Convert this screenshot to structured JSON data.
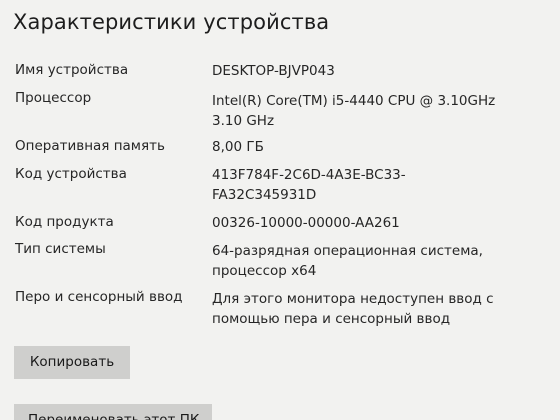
{
  "section": {
    "title": "Характеристики устройства"
  },
  "specs": [
    {
      "label": "Имя устройства",
      "value": [
        "DESKTOP-BJVP043"
      ]
    },
    {
      "label": "Процессор",
      "value": [
        "Intel(R) Core(TM) i5-4440 CPU @ 3.10GHz",
        "3.10 GHz"
      ]
    },
    {
      "label": "Оперативная память",
      "value": [
        "8,00 ГБ"
      ]
    },
    {
      "label": "Код устройства",
      "value": [
        "413F784F-2C6D-4A3E-BC33-",
        "FA32C345931D"
      ]
    },
    {
      "label": "Код продукта",
      "value": [
        "00326-10000-00000-AA261"
      ]
    },
    {
      "label": "Тип системы",
      "value": [
        "64-разрядная операционная система,",
        "процессор x64"
      ]
    },
    {
      "label": "Перо и сенсорный ввод",
      "value": [
        "Для этого монитора недоступен ввод с",
        "помощью пера и сенсорный ввод"
      ]
    }
  ],
  "buttons": {
    "copy_label": "Копировать",
    "rename_label": "Переименовать этот ПК"
  }
}
